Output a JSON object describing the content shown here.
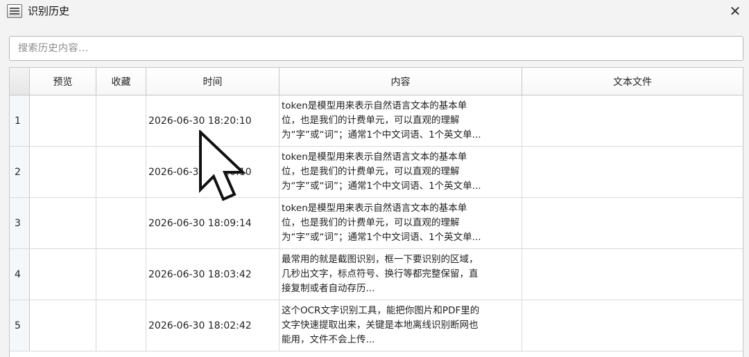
{
  "window": {
    "title": "识别历史",
    "close_label": "✕"
  },
  "search": {
    "placeholder": "搜索历史内容..."
  },
  "table": {
    "columns": [
      "",
      "预览",
      "收藏",
      "时间",
      "内容",
      "文本文件"
    ],
    "rows": [
      {
        "num": "1",
        "time": "2026-06-30 18:20:10",
        "content": "token是模型用来表示自然语言文本的基本单\n位，也是我们的计费单元，可以直观的理解\n为“字”或“词”；通常1个中文词语、1个英文单..."
      },
      {
        "num": "2",
        "time": "2026-06-30 18:20:10",
        "content": "token是模型用来表示自然语言文本的基本单\n位，也是我们的计费单元，可以直观的理解\n为“字”或“词”；通常1个中文词语、1个英文单..."
      },
      {
        "num": "3",
        "time": "2026-06-30 18:09:14",
        "content": "token是模型用来表示自然语言文本的基本单\n位，也是我们的计费单元，可以直观的理解\n为“字”或“词”；通常1个中文词语、1个英文单..."
      },
      {
        "num": "4",
        "time": "2026-06-30 18:03:42",
        "content": "最常用的就是截图识别，框一下要识别的区域，\n几秒出文字，标点符号、换行等都完整保留，直\n接复制或者自动存历..."
      },
      {
        "num": "5",
        "time": "2026-06-30 18:02:42",
        "content": "这个OCR文字识别工具，能把你图片和PDF里的\n文字快速提取出来，关键是本地离线识别断网也\n能用，文件不会上传..."
      }
    ]
  }
}
